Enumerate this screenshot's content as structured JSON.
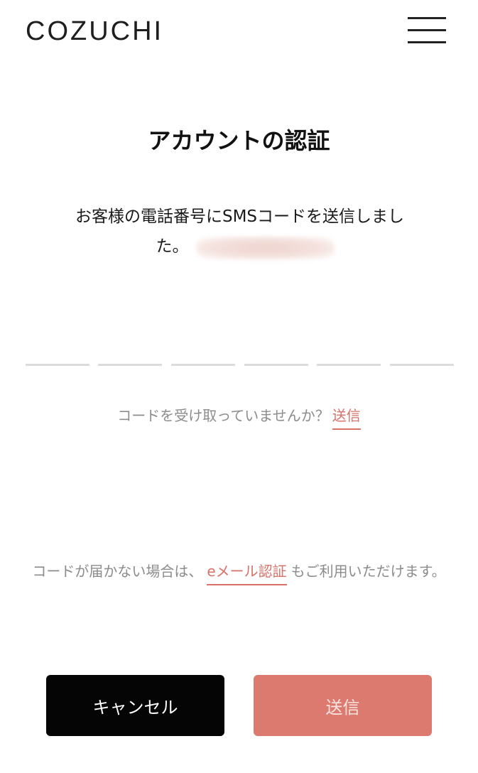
{
  "header": {
    "logo_text": "COZUCHI",
    "menu_icon": "hamburger-menu-icon"
  },
  "main": {
    "title": "アカウントの認証",
    "message_line1": "お客様の電話番号にSMSコードを送信しまし",
    "message_line2": "た。",
    "code_digits": [
      "",
      "",
      "",
      "",
      "",
      ""
    ],
    "resend_prompt": "コードを受け取っていませんか？",
    "resend_link": "送信",
    "email_note_prefix": "コードが届かない場合は、",
    "email_link": "eメール認証",
    "email_note_suffix": "もご利用いただけます。"
  },
  "buttons": {
    "cancel_label": "キャンセル",
    "submit_label": "送信"
  },
  "colors": {
    "accent": "#d87269",
    "submit_bg": "#dc7a70",
    "cancel_bg": "#050505",
    "muted_text": "#8c8c8c"
  }
}
